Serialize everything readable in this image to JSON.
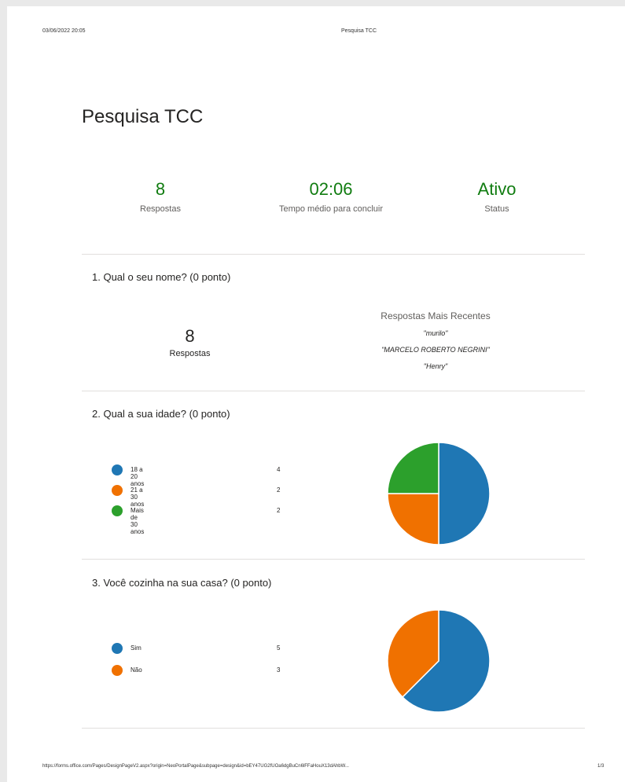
{
  "header": {
    "date": "03/06/2022 20:05",
    "title": "Pesquisa TCC"
  },
  "form_title": "Pesquisa TCC",
  "stats": [
    {
      "value": "8",
      "label": "Respostas"
    },
    {
      "value": "02:06",
      "label": "Tempo médio para concluir"
    },
    {
      "value": "Ativo",
      "label": "Status"
    }
  ],
  "q1": {
    "title": "1.  Qual o seu nome? (0 ponto)",
    "count": "8",
    "count_label": "Respostas",
    "recent_title": "Respostas Mais Recentes",
    "recent": [
      "\"murilo\"",
      "\"MARCELO ROBERTO NEGRINI\"",
      "\"Henry\""
    ]
  },
  "q2": {
    "title": "2.  Qual a sua idade? (0 ponto)",
    "options": [
      {
        "label": "18 a 20 anos",
        "count": "4",
        "color": "#1f77b4"
      },
      {
        "label": "21 a 30 anos",
        "count": "2",
        "color": "#f07100"
      },
      {
        "label": "Mais de 30 anos",
        "count": "2",
        "color": "#2ca02c"
      }
    ]
  },
  "q3": {
    "title": "3.  Você cozinha na sua casa? (0 ponto)",
    "options": [
      {
        "label": "Sim",
        "count": "5",
        "color": "#1f77b4"
      },
      {
        "label": "Não",
        "count": "3",
        "color": "#f07100"
      }
    ]
  },
  "chart_data": [
    {
      "type": "pie",
      "categories": [
        "18 a 20 anos",
        "21 a 30 anos",
        "Mais de 30 anos"
      ],
      "values": [
        4,
        2,
        2
      ],
      "colors": [
        "#1f77b4",
        "#f07100",
        "#2ca02c"
      ],
      "title": ""
    },
    {
      "type": "pie",
      "categories": [
        "Sim",
        "Não"
      ],
      "values": [
        5,
        3
      ],
      "colors": [
        "#1f77b4",
        "#f07100"
      ],
      "title": ""
    }
  ],
  "footer": {
    "url": "https://forms.office.com/Pages/DesignPageV2.aspx?origin=NeoPortalPage&subpage=design&id=bEY47UG2fUOa6dgBuCn6lFFaHouX13dAhbW...",
    "page": "1/3"
  }
}
